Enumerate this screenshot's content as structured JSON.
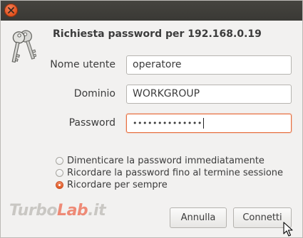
{
  "dialog": {
    "title": "Richiesta password per 192.168.0.19"
  },
  "fields": {
    "username": {
      "label": "Nome utente",
      "value": "operatore"
    },
    "domain": {
      "label": "Dominio",
      "value": "WORKGROUP"
    },
    "password": {
      "label": "Password",
      "masked_value": "••••••••••••••"
    }
  },
  "remember_options": [
    {
      "label": "Dimenticare la password immediatamente",
      "checked": false
    },
    {
      "label": "Ricordare la password fino al termine sessione",
      "checked": false
    },
    {
      "label": "Ricordare per sempre",
      "checked": true
    }
  ],
  "buttons": {
    "cancel_label": "Annulla",
    "connect_label": "Connetti"
  },
  "watermark": {
    "part1": "Turbo",
    "part2": "Lab",
    "part3": ".it"
  },
  "icons": {
    "close": "close-icon",
    "keys": "keys-icon",
    "pointer": "mouse-pointer-icon"
  },
  "colors": {
    "accent": "#e8703f",
    "titlebar": "#3e3d39",
    "close_button": "#e3541f"
  }
}
